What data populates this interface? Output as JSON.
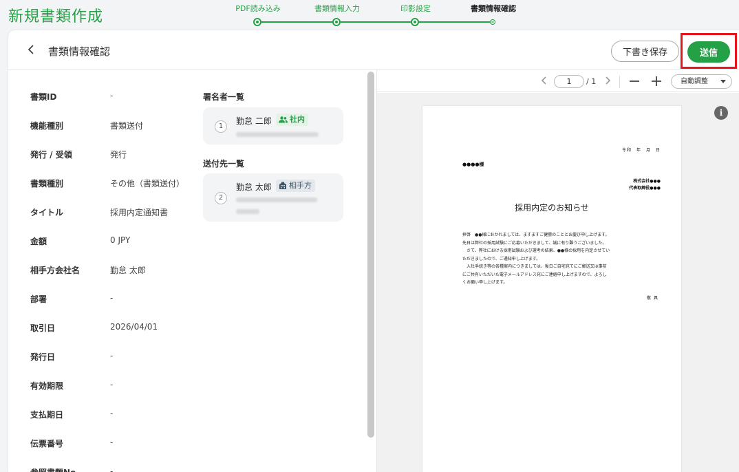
{
  "page": {
    "title": "新規書類作成"
  },
  "stepper": {
    "steps": [
      {
        "label": "PDF読み込み"
      },
      {
        "label": "書類情報入力"
      },
      {
        "label": "印影設定"
      },
      {
        "label": "書類情報確認"
      }
    ],
    "current": 4
  },
  "header": {
    "title": "書類情報確認",
    "draft_label": "下書き保存",
    "send_label": "送信"
  },
  "fields": [
    {
      "label": "書類ID",
      "value": "-"
    },
    {
      "label": "機能種別",
      "value": "書類送付"
    },
    {
      "label": "発行 / 受領",
      "value": "発行"
    },
    {
      "label": "書類種別",
      "value": "その他（書類送付）"
    },
    {
      "label": "タイトル",
      "value": "採用内定通知書"
    },
    {
      "label": "金額",
      "value": "0 JPY"
    },
    {
      "label": "相手方会社名",
      "value": "勤怠 太郎"
    },
    {
      "label": "部署",
      "value": "-"
    },
    {
      "label": "取引日",
      "value": "2026/04/01"
    },
    {
      "label": "発行日",
      "value": "-"
    },
    {
      "label": "有効期限",
      "value": "-"
    },
    {
      "label": "支払期日",
      "value": "-"
    },
    {
      "label": "伝票番号",
      "value": "-"
    },
    {
      "label": "参照書類No.",
      "value": "-"
    }
  ],
  "signers": {
    "title": "署名者一覧",
    "items": [
      {
        "order": "1",
        "name": "勤怠 二郎",
        "badge": "社内"
      }
    ]
  },
  "recipients": {
    "title": "送付先一覧",
    "items": [
      {
        "order": "2",
        "name": "勤怠 太郎",
        "badge": "相手方"
      }
    ]
  },
  "viewer": {
    "current_page": "1",
    "total_pages": "/ 1",
    "zoom_label": "自動調整",
    "info_icon": "i"
  },
  "document": {
    "date_line": "令和　年　月　日",
    "recipient": "●●●●様",
    "company_name": "株式会社●●●",
    "representative": "代表取締役●●●",
    "title": "採用内定のお知らせ",
    "body": [
      "拝啓　●●様におかれましては、ますますご健勝のこととお慶び申し上げます。",
      "先日は弊社の採用試験にご応募いただきまして、誠に有り難うございました。",
      "さて、弊社における採用試験および選考の結果、●●様の採用を内定させてい",
      "ただきましたので、ご通知申し上げます。",
      "入社手続き等の各種案内につきましては、後日ご自宅宛てにご郵送又は事前",
      "にご共有いただいた電子メールアドレス宛にご連絡申し上げますので、よろし",
      "くお願い申し上げます。"
    ],
    "closing": "敬具"
  },
  "colors": {
    "brand_green": "#24a146",
    "highlight_red": "#e8141c"
  }
}
